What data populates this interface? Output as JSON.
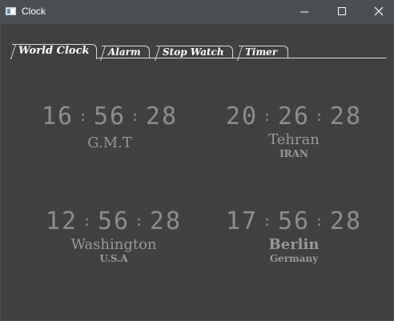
{
  "window": {
    "title": "Clock",
    "controls": [
      "minimize-icon",
      "maximize-icon",
      "close-icon"
    ]
  },
  "tabs": [
    {
      "label": "World Clock",
      "active": true
    },
    {
      "label": "Alarm",
      "active": false
    },
    {
      "label": "Stop Watch",
      "active": false
    },
    {
      "label": "Timer",
      "active": false
    }
  ],
  "clocks": [
    {
      "hours": "16",
      "minutes": "56",
      "seconds": "28",
      "sep": ":",
      "city": "G.M.T",
      "country": ""
    },
    {
      "hours": "20",
      "minutes": "26",
      "seconds": "28",
      "sep": ":",
      "city": "Tehran",
      "country": "IRAN"
    },
    {
      "hours": "12",
      "minutes": "56",
      "seconds": "28",
      "sep": ":",
      "city": "Washington",
      "country": "U.S.A"
    },
    {
      "hours": "17",
      "minutes": "56",
      "seconds": "28",
      "sep": ":",
      "city": "Berlin",
      "country": "Germany"
    }
  ],
  "colors": {
    "background": "#404040",
    "titlebar": "#4b4f54",
    "digits": "#8e8e8e",
    "labels": "#9a9a9a",
    "tab_text": "#ffffff"
  }
}
